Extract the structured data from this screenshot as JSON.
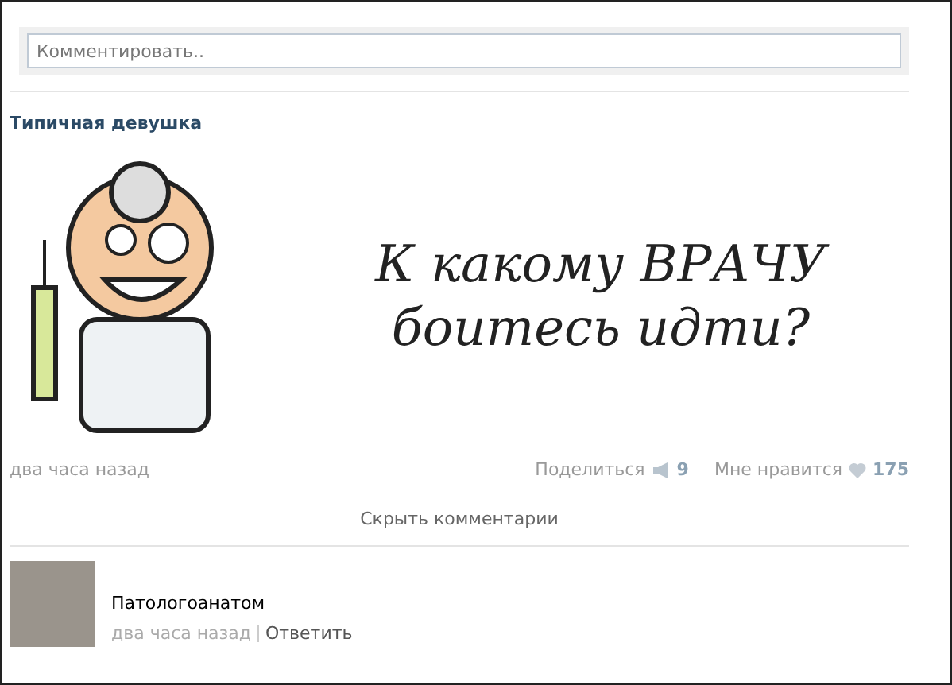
{
  "comment_box": {
    "placeholder": "Комментировать.."
  },
  "post": {
    "author": "Типичная девушка",
    "image_text": [
      "К какому ВРАЧУ",
      "боитесь идти?"
    ],
    "time": "два часа назад",
    "share": {
      "label": "Поделиться",
      "count": "9"
    },
    "like": {
      "label": "Мне нравится",
      "count": "175"
    }
  },
  "hide_comments": "Скрыть комментарии",
  "comments": [
    {
      "text": "Патологоанатом",
      "time": "два часа назад",
      "reply": "Ответить"
    }
  ]
}
